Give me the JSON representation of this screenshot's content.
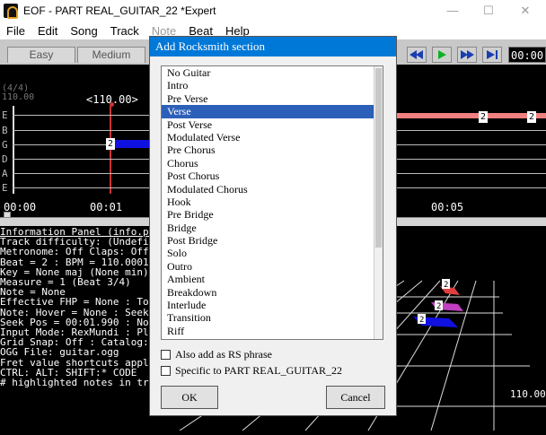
{
  "window": {
    "title": "EOF - PART REAL_GUITAR_22 *Expert",
    "controls": [
      "—",
      "☐",
      "✕"
    ]
  },
  "menu": [
    "File",
    "Edit",
    "Song",
    "Track",
    "Note",
    "Beat",
    "Help"
  ],
  "difficulty_tabs": [
    "Easy",
    "Medium"
  ],
  "time_readout": "00:00",
  "editor": {
    "ts_label": "(4/4)",
    "tempo_left": "110.00",
    "tempo_center": "<110.00>",
    "strings": [
      "E",
      "B",
      "G",
      "D",
      "A",
      "E"
    ],
    "note_fret": "2",
    "right_frets": [
      "2",
      "2"
    ],
    "time_labels": [
      "00:00",
      "00:01",
      "00:05"
    ]
  },
  "info_panel": {
    "lines": [
      "Information Panel (info.panel",
      "Track difficulty: (Undefined)",
      "Metronome: Off  Claps: Off  T",
      "Beat = 2 : BPM = 110.000110",
      "Key = None maj (None min)",
      "Measure = 1 (Beat 3/4)",
      "Note = None",
      "Effective FHP = None : Tone",
      "Note: Hover = None : Seek =",
      "Seek Pos = 00:01.990 : Notes",
      "Input Mode: RexMundi : Pla",
      "Grid Snap: Off : Catalog: 0",
      "OGG File: guitar.ogg",
      "Fret value shortcuts apply t",
      "CTRL:  ALT:  SHIFT:* CODE",
      "# highlighted notes in track"
    ]
  },
  "preview": {
    "tempo_label": "110.00",
    "note_labels": [
      "2",
      "2",
      "2"
    ]
  },
  "dialog": {
    "title": "Add Rocksmith section",
    "items": [
      "No Guitar",
      "Intro",
      "Pre Verse",
      "Verse",
      "Post Verse",
      "Modulated Verse",
      "Pre Chorus",
      "Chorus",
      "Post Chorus",
      "Modulated Chorus",
      "Hook",
      "Pre Bridge",
      "Bridge",
      "Post Bridge",
      "Solo",
      "Outro",
      "Ambient",
      "Breakdown",
      "Interlude",
      "Transition",
      "Riff"
    ],
    "selected": "Verse",
    "check1": "Also add as RS phrase",
    "check2": "Specific to PART REAL_GUITAR_22",
    "ok": "OK",
    "cancel": "Cancel"
  },
  "colors": {
    "selection": "#2c5fb8",
    "title_bar_active": "#0078d7",
    "note_blue": "#1010e0",
    "note_pink": "#f08080"
  }
}
